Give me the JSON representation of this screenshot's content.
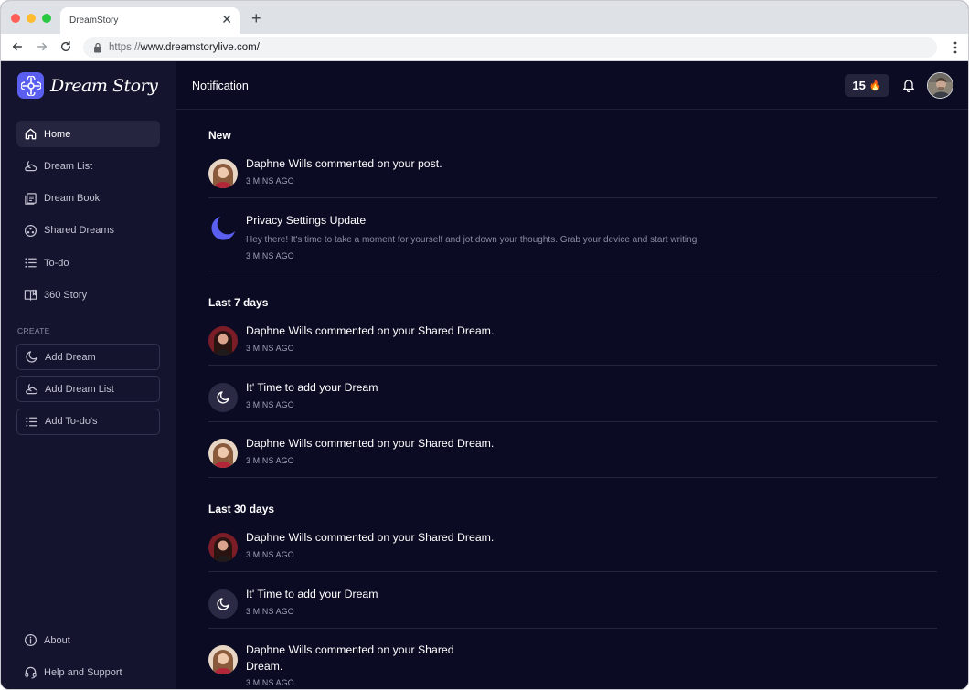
{
  "browser": {
    "tab_title": "DreamStory",
    "tab_close": "✕",
    "new_tab": "+",
    "url_scheme": "https://",
    "url_host": "www.dreamstorylive.com/"
  },
  "brand": {
    "name": "Dream Story",
    "accent": "#5b5ff0"
  },
  "sidebar": {
    "items": [
      {
        "label": "Home",
        "icon": "home-icon",
        "active": true
      },
      {
        "label": "Dream List",
        "icon": "moon-cloud-icon"
      },
      {
        "label": "Dream Book",
        "icon": "book-icon"
      },
      {
        "label": "Shared Dreams",
        "icon": "shared-icon"
      },
      {
        "label": "To-do",
        "icon": "list-icon"
      },
      {
        "label": "360 Story",
        "icon": "open-book-icon"
      }
    ],
    "create_label": "CREATE",
    "create": [
      {
        "label": "Add Dream",
        "icon": "moon-icon"
      },
      {
        "label": "Add Dream List",
        "icon": "moon-cloud-icon"
      },
      {
        "label": "Add To-do's",
        "icon": "list-icon"
      }
    ],
    "footer": [
      {
        "label": "About",
        "icon": "info-icon"
      },
      {
        "label": "Help and Support",
        "icon": "headset-icon"
      }
    ]
  },
  "header": {
    "title": "Notification",
    "streak_count": "15",
    "streak_emoji": "🔥"
  },
  "groups": [
    {
      "title": "New",
      "items": [
        {
          "avatar": "woman-light",
          "title": "Daphne Wills commented on your post.",
          "time": "3 MINS AGO"
        },
        {
          "avatar": "moon-blue",
          "title": "Privacy Settings Update",
          "body": "Hey there! It's time to take a moment for yourself and jot down your thoughts. Grab your device and start writing",
          "time": "3 MINS AGO"
        }
      ]
    },
    {
      "title": "Last 7 days",
      "items": [
        {
          "avatar": "woman-red",
          "title": "Daphne Wills commented on your Shared Dream.",
          "time": "3 MINS AGO"
        },
        {
          "avatar": "moon-dark",
          "title": "It' Time to add your Dream",
          "time": "3 MINS AGO"
        },
        {
          "avatar": "woman-light",
          "title": "Daphne Wills commented on your Shared Dream.",
          "time": "3 MINS AGO"
        }
      ]
    },
    {
      "title": "Last 30 days",
      "items": [
        {
          "avatar": "woman-red",
          "title": "Daphne Wills commented on your Shared Dream.",
          "time": "3 MINS AGO"
        },
        {
          "avatar": "moon-dark",
          "title": "It' Time to add your Dream",
          "time": "3 MINS AGO"
        },
        {
          "avatar": "woman-light",
          "title_line1": "Daphne Wills commented on your Shared",
          "title_line2": "Dream.",
          "time": "3 MINS AGO"
        }
      ]
    }
  ]
}
